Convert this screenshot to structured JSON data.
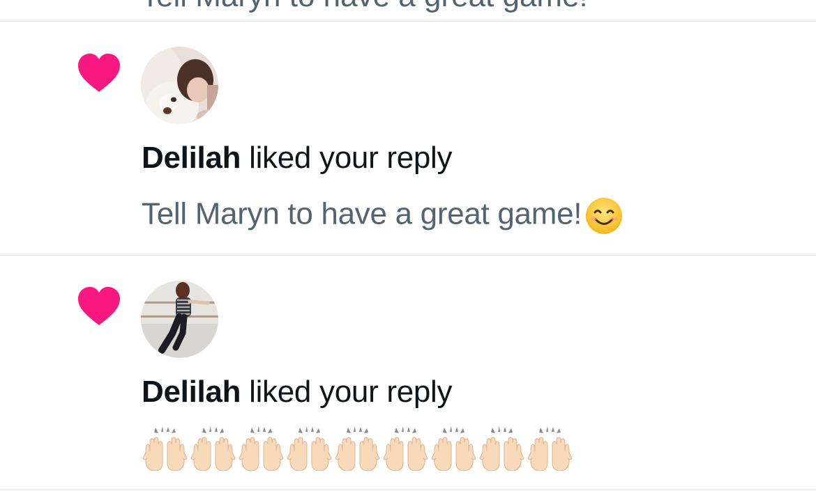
{
  "previous_item": {
    "cut_text": "Tell Maryn to have a great game!"
  },
  "notifications": [
    {
      "user": "Delilah",
      "action": "liked your reply",
      "reply_text": "Tell Maryn to have a great game!",
      "reply_emoji": "smiling-face-with-smiling-eyes"
    },
    {
      "user": "Delilah",
      "action": "liked your reply",
      "reply_text": "",
      "reply_emoji": "raising-hands",
      "reply_emoji_count": 9
    }
  ],
  "colors": {
    "heart": "#f91880",
    "text_primary": "#0f1419",
    "text_secondary": "#536471",
    "divider": "#dfe3e6"
  },
  "icons": {
    "like": "heart-icon"
  }
}
